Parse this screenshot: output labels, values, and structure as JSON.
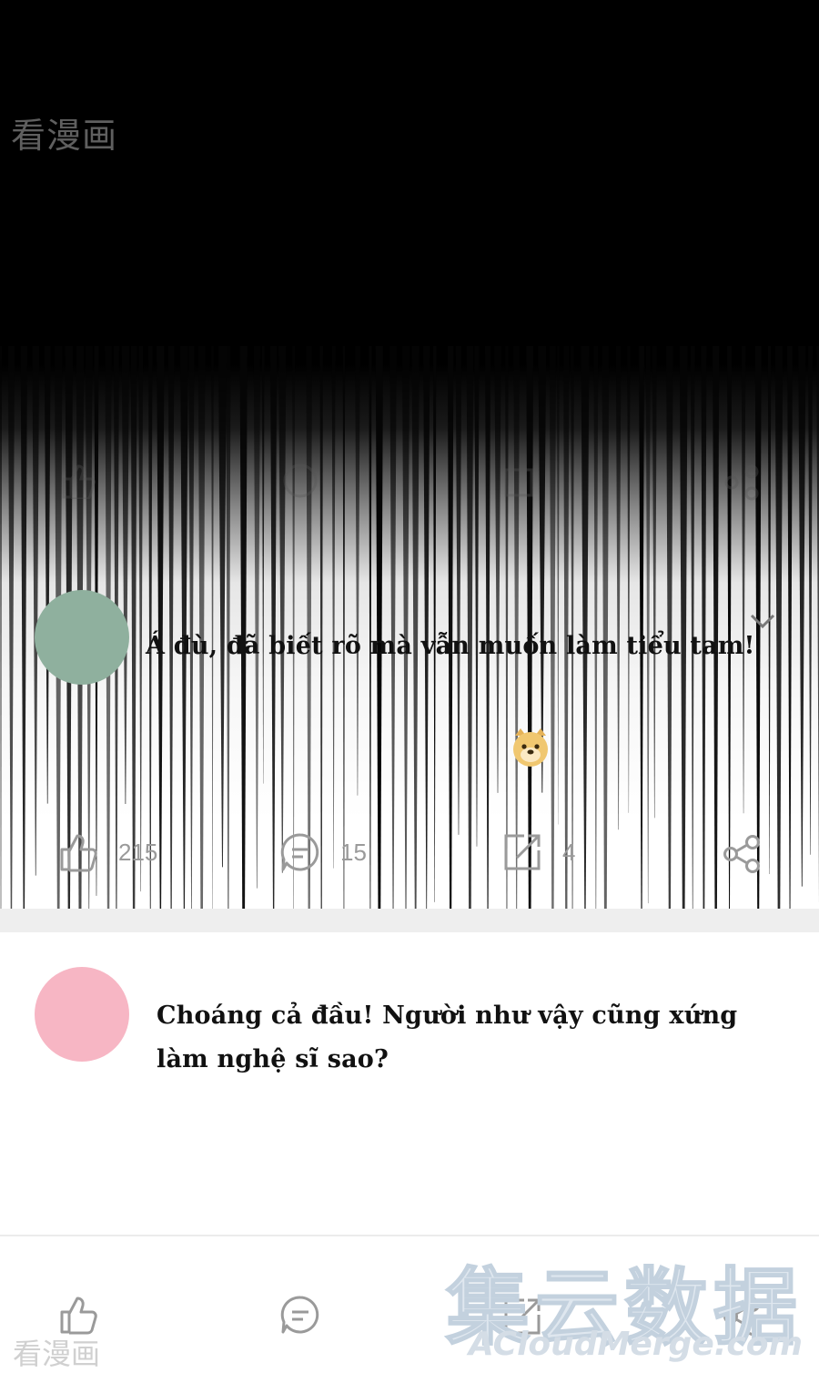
{
  "watermark_top": "看漫画",
  "watermark_bottom_left": "看漫画",
  "watermark_merge": {
    "cjk": "集云数据",
    "latin": "ACloudMerge.com"
  },
  "colors": {
    "avatar_1": "#8fb09e",
    "avatar_2": "#f7b6c4",
    "icon_gray": "#9a9a9a"
  },
  "comments": [
    {
      "text": "Á đù, đã biết rõ mà vẫn muốn làm tiểu tam!",
      "emoji": "doge-emoji",
      "actions": {
        "like_count": "215",
        "comment_count": "15",
        "repost_count": "4"
      }
    },
    {
      "text_line1": "Choáng cả đầu! Người như vậy cũng xứng",
      "text_line2": "làm nghệ sĩ sao?"
    }
  ],
  "icons": [
    "thumbs-up-icon",
    "comment-bubble-icon",
    "repost-icon",
    "share-icon",
    "chevron-down-icon"
  ]
}
